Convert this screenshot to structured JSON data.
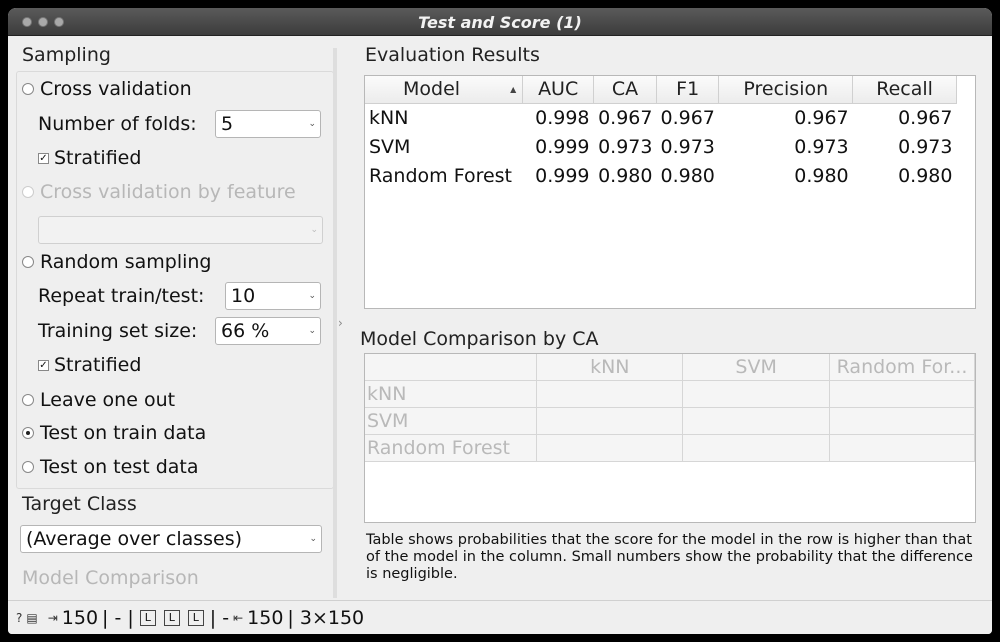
{
  "window": {
    "title": "Test and Score (1)"
  },
  "sampling": {
    "title": "Sampling",
    "cross_validation": "Cross validation",
    "folds_label": "Number of folds:",
    "folds_value": "5",
    "stratified": "Stratified",
    "cv_by_feature": "Cross validation by feature",
    "random_sampling": "Random sampling",
    "repeat_label": "Repeat train/test:",
    "repeat_value": "10",
    "train_size_label": "Training set size:",
    "train_size_value": "66 %",
    "stratified2": "Stratified",
    "leave_one_out": "Leave one out",
    "test_on_train": "Test on train data",
    "test_on_test": "Test on test data"
  },
  "target": {
    "title": "Target Class",
    "value": "(Average over classes)"
  },
  "model_comparison_label": "Model Comparison",
  "evaluation": {
    "title": "Evaluation Results",
    "columns": [
      "Model",
      "AUC",
      "CA",
      "F1",
      "Precision",
      "Recall"
    ],
    "rows": [
      [
        "kNN",
        "0.998",
        "0.967",
        "0.967",
        "0.967",
        "0.967"
      ],
      [
        "SVM",
        "0.999",
        "0.973",
        "0.973",
        "0.973",
        "0.973"
      ],
      [
        "Random Forest",
        "0.999",
        "0.980",
        "0.980",
        "0.980",
        "0.980"
      ]
    ]
  },
  "comparison": {
    "title": "Model Comparison by CA",
    "columns": [
      "kNN",
      "SVM",
      "Random For..."
    ],
    "rows": [
      "kNN",
      "SVM",
      "Random Forest"
    ],
    "note": "Table shows probabilities that the score for the model in the row is higher than that of the model in the column. Small numbers show the probability that the difference is negligible."
  },
  "status": {
    "input_count": "150",
    "sep1": "| - |",
    "sep2": "| -",
    "output_count": "150",
    "shape": "| 3×150",
    "icons": [
      "help-icon",
      "report-icon",
      "input-icon",
      "learner-icon",
      "output-icon"
    ]
  },
  "colors": {
    "window_bg": "#efefef",
    "titlebar": "#444444",
    "disabled_text": "#b7b7b7"
  }
}
